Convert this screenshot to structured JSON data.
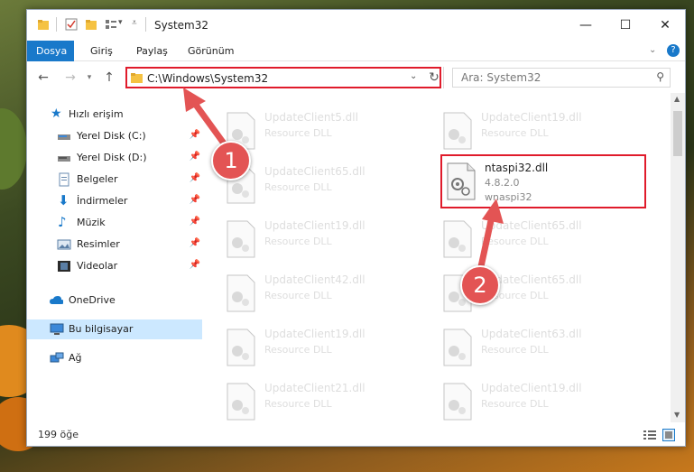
{
  "window": {
    "title": "System32"
  },
  "ribbon": {
    "tabs": [
      "Dosya",
      "Giriş",
      "Paylaş",
      "Görünüm"
    ]
  },
  "address": {
    "path": "C:\\Windows\\System32",
    "search_placeholder": "Ara: System32"
  },
  "sidebar": {
    "items": [
      {
        "label": "Hızlı erişim",
        "icon": "star-icon"
      },
      {
        "label": "Yerel Disk (C:)",
        "icon": "drive-icon"
      },
      {
        "label": "Yerel Disk (D:)",
        "icon": "drive-icon"
      },
      {
        "label": "Belgeler",
        "icon": "documents-icon"
      },
      {
        "label": "İndirmeler",
        "icon": "download-icon"
      },
      {
        "label": "Müzik",
        "icon": "music-icon"
      },
      {
        "label": "Resimler",
        "icon": "pictures-icon"
      },
      {
        "label": "Videolar",
        "icon": "video-icon"
      },
      {
        "label": "OneDrive",
        "icon": "cloud-icon"
      },
      {
        "label": "Bu bilgisayar",
        "icon": "computer-icon"
      },
      {
        "label": "Ağ",
        "icon": "network-icon"
      }
    ]
  },
  "files": {
    "left": [
      {
        "name": "UpdateClient5.dll",
        "desc": "Resource DLL"
      },
      {
        "name": "UpdateClient65.dll",
        "desc": "Resource DLL"
      },
      {
        "name": "UpdateClient19.dll",
        "desc": "Resource DLL"
      },
      {
        "name": "UpdateClient42.dll",
        "desc": "Resource DLL"
      },
      {
        "name": "UpdateClient19.dll",
        "desc": "Resource DLL"
      },
      {
        "name": "UpdateClient21.dll",
        "desc": "Resource DLL"
      }
    ],
    "right": [
      {
        "name": "UpdateClient19.dll",
        "desc": "Resource DLL"
      },
      {
        "name": "UpdateClient65.dll",
        "desc": "Resource DLL"
      },
      {
        "name": "UpdateClient65.dll",
        "desc": "Resource DLL"
      },
      {
        "name": "UpdateClient63.dll",
        "desc": "Resource DLL"
      },
      {
        "name": "UpdateClient19.dll",
        "desc": "Resource DLL"
      }
    ],
    "highlighted": {
      "name": "ntaspi32.dll",
      "version": "4.8.2.0",
      "desc": "wnaspi32"
    }
  },
  "status": {
    "count": "199 öğe"
  },
  "annotations": {
    "step1": "1",
    "step2": "2",
    "color": "#e35454"
  }
}
